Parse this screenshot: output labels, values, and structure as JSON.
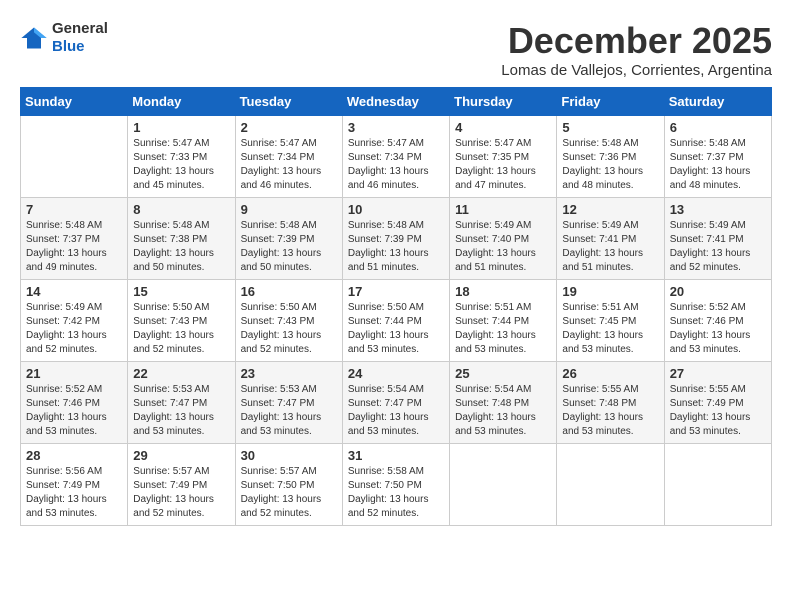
{
  "logo": {
    "general": "General",
    "blue": "Blue"
  },
  "title": "December 2025",
  "subtitle": "Lomas de Vallejos, Corrientes, Argentina",
  "weekdays": [
    "Sunday",
    "Monday",
    "Tuesday",
    "Wednesday",
    "Thursday",
    "Friday",
    "Saturday"
  ],
  "weeks": [
    [
      {
        "day": "",
        "info": ""
      },
      {
        "day": "1",
        "info": "Sunrise: 5:47 AM\nSunset: 7:33 PM\nDaylight: 13 hours\nand 45 minutes."
      },
      {
        "day": "2",
        "info": "Sunrise: 5:47 AM\nSunset: 7:34 PM\nDaylight: 13 hours\nand 46 minutes."
      },
      {
        "day": "3",
        "info": "Sunrise: 5:47 AM\nSunset: 7:34 PM\nDaylight: 13 hours\nand 46 minutes."
      },
      {
        "day": "4",
        "info": "Sunrise: 5:47 AM\nSunset: 7:35 PM\nDaylight: 13 hours\nand 47 minutes."
      },
      {
        "day": "5",
        "info": "Sunrise: 5:48 AM\nSunset: 7:36 PM\nDaylight: 13 hours\nand 48 minutes."
      },
      {
        "day": "6",
        "info": "Sunrise: 5:48 AM\nSunset: 7:37 PM\nDaylight: 13 hours\nand 48 minutes."
      }
    ],
    [
      {
        "day": "7",
        "info": "Sunrise: 5:48 AM\nSunset: 7:37 PM\nDaylight: 13 hours\nand 49 minutes."
      },
      {
        "day": "8",
        "info": "Sunrise: 5:48 AM\nSunset: 7:38 PM\nDaylight: 13 hours\nand 50 minutes."
      },
      {
        "day": "9",
        "info": "Sunrise: 5:48 AM\nSunset: 7:39 PM\nDaylight: 13 hours\nand 50 minutes."
      },
      {
        "day": "10",
        "info": "Sunrise: 5:48 AM\nSunset: 7:39 PM\nDaylight: 13 hours\nand 51 minutes."
      },
      {
        "day": "11",
        "info": "Sunrise: 5:49 AM\nSunset: 7:40 PM\nDaylight: 13 hours\nand 51 minutes."
      },
      {
        "day": "12",
        "info": "Sunrise: 5:49 AM\nSunset: 7:41 PM\nDaylight: 13 hours\nand 51 minutes."
      },
      {
        "day": "13",
        "info": "Sunrise: 5:49 AM\nSunset: 7:41 PM\nDaylight: 13 hours\nand 52 minutes."
      }
    ],
    [
      {
        "day": "14",
        "info": "Sunrise: 5:49 AM\nSunset: 7:42 PM\nDaylight: 13 hours\nand 52 minutes."
      },
      {
        "day": "15",
        "info": "Sunrise: 5:50 AM\nSunset: 7:43 PM\nDaylight: 13 hours\nand 52 minutes."
      },
      {
        "day": "16",
        "info": "Sunrise: 5:50 AM\nSunset: 7:43 PM\nDaylight: 13 hours\nand 52 minutes."
      },
      {
        "day": "17",
        "info": "Sunrise: 5:50 AM\nSunset: 7:44 PM\nDaylight: 13 hours\nand 53 minutes."
      },
      {
        "day": "18",
        "info": "Sunrise: 5:51 AM\nSunset: 7:44 PM\nDaylight: 13 hours\nand 53 minutes."
      },
      {
        "day": "19",
        "info": "Sunrise: 5:51 AM\nSunset: 7:45 PM\nDaylight: 13 hours\nand 53 minutes."
      },
      {
        "day": "20",
        "info": "Sunrise: 5:52 AM\nSunset: 7:46 PM\nDaylight: 13 hours\nand 53 minutes."
      }
    ],
    [
      {
        "day": "21",
        "info": "Sunrise: 5:52 AM\nSunset: 7:46 PM\nDaylight: 13 hours\nand 53 minutes."
      },
      {
        "day": "22",
        "info": "Sunrise: 5:53 AM\nSunset: 7:47 PM\nDaylight: 13 hours\nand 53 minutes."
      },
      {
        "day": "23",
        "info": "Sunrise: 5:53 AM\nSunset: 7:47 PM\nDaylight: 13 hours\nand 53 minutes."
      },
      {
        "day": "24",
        "info": "Sunrise: 5:54 AM\nSunset: 7:47 PM\nDaylight: 13 hours\nand 53 minutes."
      },
      {
        "day": "25",
        "info": "Sunrise: 5:54 AM\nSunset: 7:48 PM\nDaylight: 13 hours\nand 53 minutes."
      },
      {
        "day": "26",
        "info": "Sunrise: 5:55 AM\nSunset: 7:48 PM\nDaylight: 13 hours\nand 53 minutes."
      },
      {
        "day": "27",
        "info": "Sunrise: 5:55 AM\nSunset: 7:49 PM\nDaylight: 13 hours\nand 53 minutes."
      }
    ],
    [
      {
        "day": "28",
        "info": "Sunrise: 5:56 AM\nSunset: 7:49 PM\nDaylight: 13 hours\nand 53 minutes."
      },
      {
        "day": "29",
        "info": "Sunrise: 5:57 AM\nSunset: 7:49 PM\nDaylight: 13 hours\nand 52 minutes."
      },
      {
        "day": "30",
        "info": "Sunrise: 5:57 AM\nSunset: 7:50 PM\nDaylight: 13 hours\nand 52 minutes."
      },
      {
        "day": "31",
        "info": "Sunrise: 5:58 AM\nSunset: 7:50 PM\nDaylight: 13 hours\nand 52 minutes."
      },
      {
        "day": "",
        "info": ""
      },
      {
        "day": "",
        "info": ""
      },
      {
        "day": "",
        "info": ""
      }
    ]
  ]
}
